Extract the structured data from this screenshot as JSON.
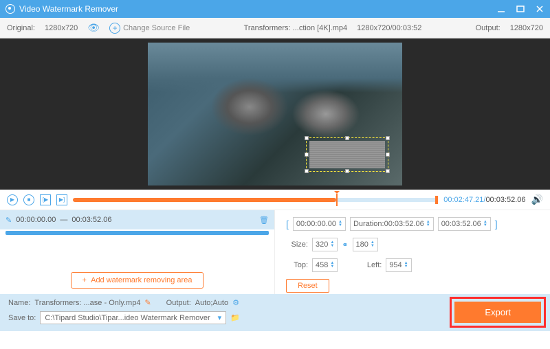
{
  "titlebar": {
    "title": "Video Watermark Remover"
  },
  "topbar": {
    "original_label": "Original:",
    "original_res": "1280x720",
    "change_source": "Change Source File",
    "file_name": "Transformers: ...ction [4K].mp4",
    "file_res_dur": "1280x720/00:03:52",
    "output_label": "Output:",
    "output_res": "1280x720"
  },
  "timeline": {
    "current": "00:02:47.21",
    "total": "00:03:52.06"
  },
  "range": {
    "start": "00:00:00.00",
    "sep": "—",
    "end": "00:03:52.06"
  },
  "controls": {
    "start_time": "00:00:00.00",
    "duration_label": "Duration:",
    "duration": "00:03:52.06",
    "end_time": "00:03:52.06",
    "size_label": "Size:",
    "width": "320",
    "height": "180",
    "top_label": "Top:",
    "top": "458",
    "left_label": "Left:",
    "left": "954",
    "reset": "Reset"
  },
  "addwm": "Add watermark removing area",
  "footer": {
    "name_label": "Name:",
    "name_value": "Transformers: ...ase - Only.mp4",
    "output_label": "Output:",
    "output_value": "Auto;Auto",
    "save_label": "Save to:",
    "save_path": "C:\\Tipard Studio\\Tipar...ideo Watermark Remover",
    "export": "Export"
  }
}
